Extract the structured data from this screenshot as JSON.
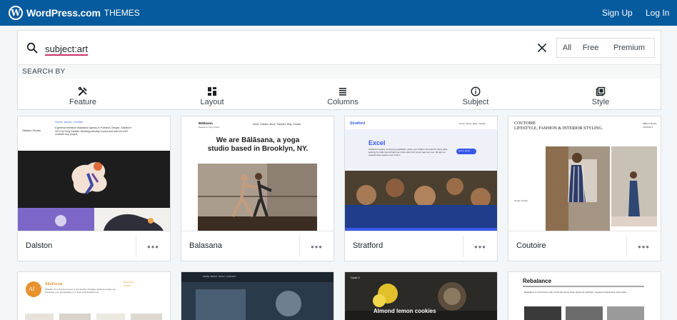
{
  "masthead": {
    "logo": "W",
    "brand": "WordPress.com",
    "section": "THEMES",
    "signup": "Sign Up",
    "login": "Log In"
  },
  "search": {
    "query": "subject:art",
    "filters": [
      "All",
      "Free",
      "Premium"
    ],
    "search_by_label": "SEARCH BY",
    "facets": [
      "Feature",
      "Layout",
      "Columns",
      "Subject",
      "Style"
    ]
  },
  "themes": [
    {
      "name": "Dalston",
      "more": "•••",
      "preview": {
        "site_title": "Dalston Studio",
        "nav": "Home  About  Contact",
        "intro": "A general freelance illustration agency in Portland, Oregon. Started in 2010 by Greg Daniels. Working primarily in print and web but we'll consider any project."
      }
    },
    {
      "name": "Balasana",
      "more": "•••",
      "preview": {
        "site_title": "Bālāsana",
        "tagline": "Balasana Yoga Studio",
        "nav": "Home  Classes  About  Teachers  Blog  Contact",
        "headline": "We are Bālāsana, a yoga studio based in Brooklyn, NY."
      }
    },
    {
      "name": "Stratford",
      "more": "•••",
      "preview": {
        "site_title": "Stratford",
        "nav": "Home  About  Blog  Contact",
        "headline": "Excel",
        "body": "Stratford is a place of inspiring possibilities, where your children can build the future while learning the skills that will help them thrive after their school years are over. We ask our students what matters most to them.",
        "button": "Get in touch"
      }
    },
    {
      "name": "Coutoire",
      "more": "•••",
      "preview": {
        "site_title": "COUTOIRE",
        "tagline": "LIFESTYLE, FASHION & INTERIOR STYLING.",
        "nav": "ABOUT  BLOG  CONTACT",
        "caption": "Scrap of Fate"
      }
    },
    {
      "name": "AltoFocus",
      "preview": {
        "site_title": "AltoFocus",
        "logo_letter": "Af",
        "intro": "Whether it's a first-time event or just another Tuesday, AltoFocus helps you showcase your photography in a clean and beautiful way.",
        "nav": "Blog  About  Contact"
      }
    },
    {
      "name": "",
      "preview": {
        "nav": "HOME  ABOUT  BLOG  CONTACT"
      }
    },
    {
      "name": "",
      "preview": {
        "site_title": "Dyad 2",
        "headline": "Almond lemon cookies"
      }
    },
    {
      "name": "Rebalance",
      "preview": {
        "site_title": "Rebalance",
        "body": "Rebalance is a hip theme with a bold font and a clean layout for portfolios, freelance businesses, and a blog."
      }
    }
  ],
  "colors": {
    "masthead": "#065a9e",
    "accent": "#c9356e",
    "stratford_blue": "#3858e9",
    "altofocus_orange": "#e8912d"
  }
}
